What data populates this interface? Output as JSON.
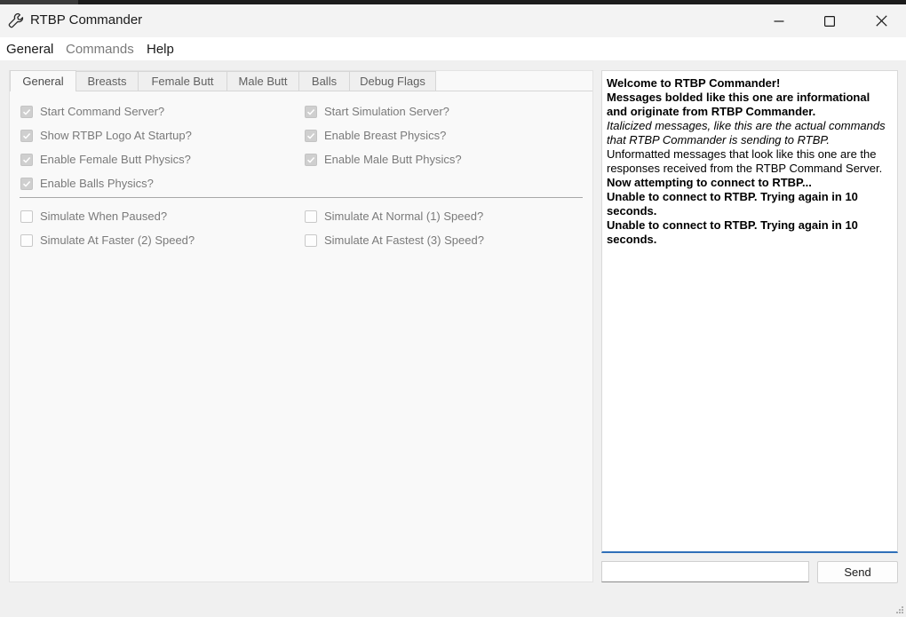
{
  "window": {
    "title": "RTBP Commander"
  },
  "menu": [
    "General",
    "Commands",
    "Help"
  ],
  "tabs": [
    "General",
    "Breasts",
    "Female Butt",
    "Male Butt",
    "Balls",
    "Debug Flags"
  ],
  "checkboxes_top": [
    {
      "label": "Start Command Server?",
      "checked": true
    },
    {
      "label": "Start Simulation Server?",
      "checked": true
    },
    {
      "label": "Show RTBP Logo At Startup?",
      "checked": true
    },
    {
      "label": "Enable Breast Physics?",
      "checked": true
    },
    {
      "label": "Enable Female Butt Physics?",
      "checked": true
    },
    {
      "label": "Enable Male Butt Physics?",
      "checked": true
    },
    {
      "label": "Enable Balls Physics?",
      "checked": true
    }
  ],
  "checkboxes_bottom": [
    {
      "label": "Simulate When Paused?",
      "checked": false
    },
    {
      "label": "Simulate At Normal (1) Speed?",
      "checked": false
    },
    {
      "label": "Simulate At Faster (2) Speed?",
      "checked": false
    },
    {
      "label": "Simulate At Fastest (3) Speed?",
      "checked": false
    }
  ],
  "log": [
    {
      "text": "Welcome to RTBP Commander!",
      "style": "bold"
    },
    {
      "text": "Messages bolded like this one are informational and originate from RTBP Commander.",
      "style": "bold"
    },
    {
      "text": "Italicized messages, like this are the actual commands that RTBP Commander is sending to RTBP.",
      "style": "italic"
    },
    {
      "text": "Unformatted messages that look like this one are the responses received from the RTBP Command Server.",
      "style": "normal"
    },
    {
      "text": "Now attempting to connect to RTBP...",
      "style": "bold"
    },
    {
      "text": "Unable to connect to RTBP. Trying again in 10 seconds.",
      "style": "bold"
    },
    {
      "text": "Unable to connect to RTBP. Trying again in 10 seconds.",
      "style": "bold"
    }
  ],
  "command_input": {
    "value": "",
    "placeholder": ""
  },
  "send_label": "Send",
  "icons": {
    "app": "wrench-icon",
    "minimize": "minimize-icon",
    "maximize": "maximize-icon",
    "close": "close-icon",
    "check": "check-icon",
    "resize": "resize-grip-icon"
  }
}
